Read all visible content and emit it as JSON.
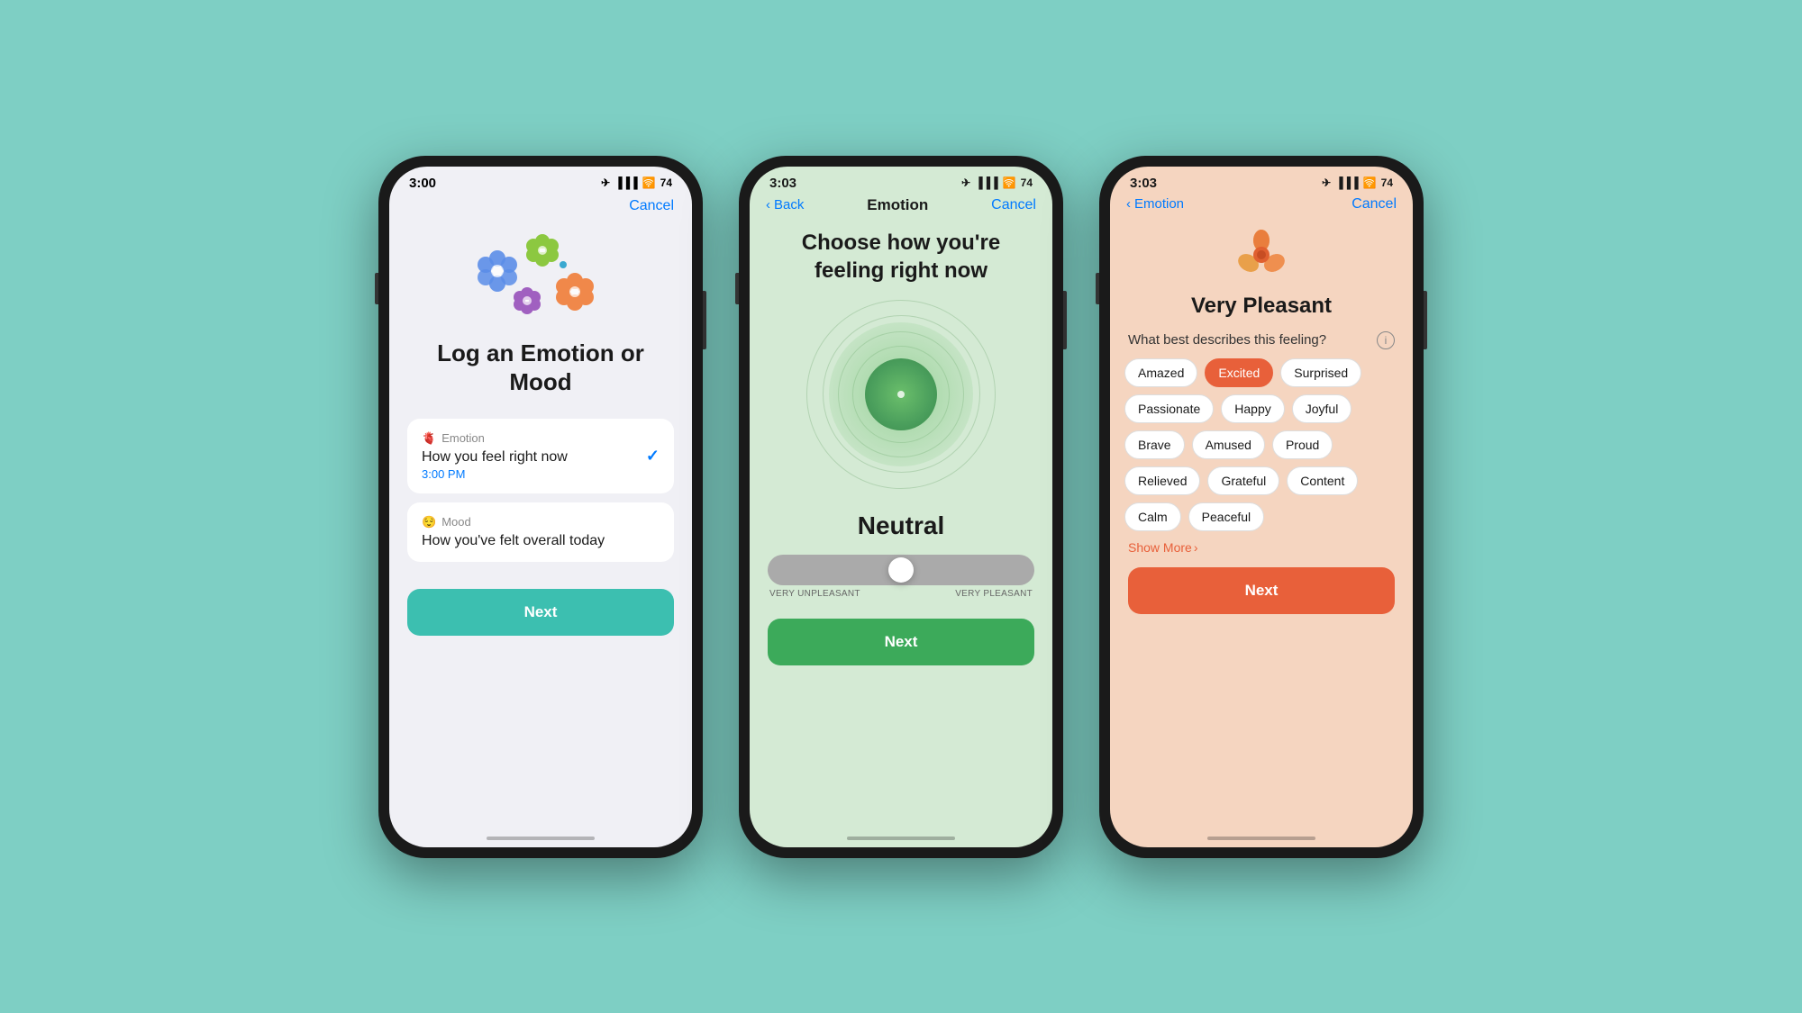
{
  "background": "#7ecfc4",
  "screen1": {
    "status_time": "3:00",
    "title": "Log an Emotion\nor Mood",
    "cancel_label": "Cancel",
    "emotion_section": {
      "icon": "🫀",
      "label": "Emotion",
      "title": "How you feel right now",
      "subtitle": "3:00 PM"
    },
    "mood_section": {
      "icon": "😌",
      "label": "Mood",
      "title": "How you've felt overall today"
    },
    "next_label": "Next"
  },
  "screen2": {
    "status_time": "3:03",
    "nav_title": "Emotion",
    "back_label": "Back",
    "cancel_label": "Cancel",
    "heading": "Choose how you're feeling right now",
    "current_feeling": "Neutral",
    "slider": {
      "left_label": "VERY UNPLEASANT",
      "right_label": "VERY PLEASANT",
      "value": 50
    },
    "next_label": "Next"
  },
  "screen3": {
    "status_time": "3:03",
    "nav_back_label": "Emotion",
    "cancel_label": "Cancel",
    "feeling_title": "Very Pleasant",
    "describes_label": "What best describes this feeling?",
    "tags": [
      {
        "label": "Amazed",
        "selected": false
      },
      {
        "label": "Excited",
        "selected": true
      },
      {
        "label": "Surprised",
        "selected": false
      },
      {
        "label": "Passionate",
        "selected": false
      },
      {
        "label": "Happy",
        "selected": false
      },
      {
        "label": "Joyful",
        "selected": false
      },
      {
        "label": "Brave",
        "selected": false
      },
      {
        "label": "Amused",
        "selected": false
      },
      {
        "label": "Proud",
        "selected": false
      },
      {
        "label": "Relieved",
        "selected": false
      },
      {
        "label": "Grateful",
        "selected": false
      },
      {
        "label": "Content",
        "selected": false
      },
      {
        "label": "Calm",
        "selected": false
      },
      {
        "label": "Peaceful",
        "selected": false
      }
    ],
    "show_more_label": "Show More",
    "next_label": "Next"
  }
}
